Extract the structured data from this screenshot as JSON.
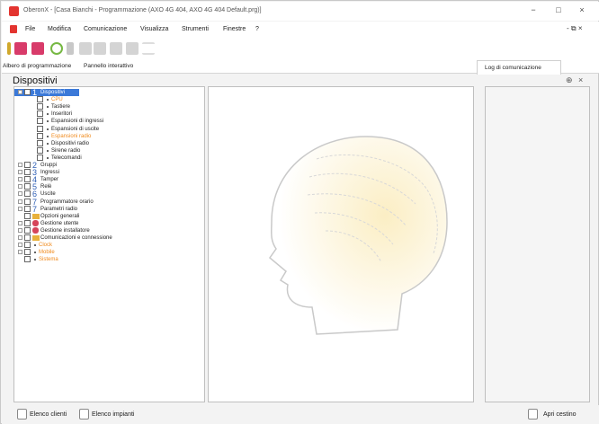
{
  "window": {
    "title": "OberonX - [Casa Bianchi - Programmazione (AXO 4G 404, AXO 4G 404 Default.prg)]",
    "minimize": "−",
    "maximize": "□",
    "close": "×"
  },
  "menu": {
    "items": [
      "File",
      "Modifica",
      "Comunicazione",
      "Visualizza",
      "Strumenti",
      "Finestre",
      "?"
    ],
    "restore": "- ⧉ ×"
  },
  "tabs": {
    "left1": "Albero di programmazione",
    "left2": "Pannello interattivo",
    "right": "Log di comunicazione"
  },
  "panel": {
    "title": "Dispositivi",
    "pin": "⊕",
    "close": "×"
  },
  "tree": [
    {
      "label": "Dispositivi",
      "selected": true
    },
    {
      "label": "CPU",
      "orange": true
    },
    {
      "label": "Tastiere"
    },
    {
      "label": "Inseritori"
    },
    {
      "label": "Espansioni di ingressi"
    },
    {
      "label": "Espansioni di uscite"
    },
    {
      "label": "Espansioni radio",
      "orange": true
    },
    {
      "label": "Dispositivi radio"
    },
    {
      "label": "Sirene radio"
    },
    {
      "label": "Telecomandi"
    },
    {
      "label": "Gruppi"
    },
    {
      "label": "Ingressi"
    },
    {
      "label": "Tamper"
    },
    {
      "label": "Relè"
    },
    {
      "label": "Uscite"
    },
    {
      "label": "Programmatore orario"
    },
    {
      "label": "Parametri radio"
    },
    {
      "label": "Opzioni generali"
    },
    {
      "label": "Gestione utente"
    },
    {
      "label": "Gestione installatore"
    },
    {
      "label": "Comunicazioni e connessione"
    },
    {
      "label": "Clock",
      "orange": true
    },
    {
      "label": "Mobile",
      "orange": true
    },
    {
      "label": "Sistema",
      "orange": true
    }
  ],
  "status": {
    "clients": "Elenco clienti",
    "plants": "Elenco impianti",
    "trash": "Apri cestino"
  },
  "colors": {
    "accent": "#3b79d8",
    "orange_text": "#f08a1c",
    "brand_red": "#e3342f"
  }
}
